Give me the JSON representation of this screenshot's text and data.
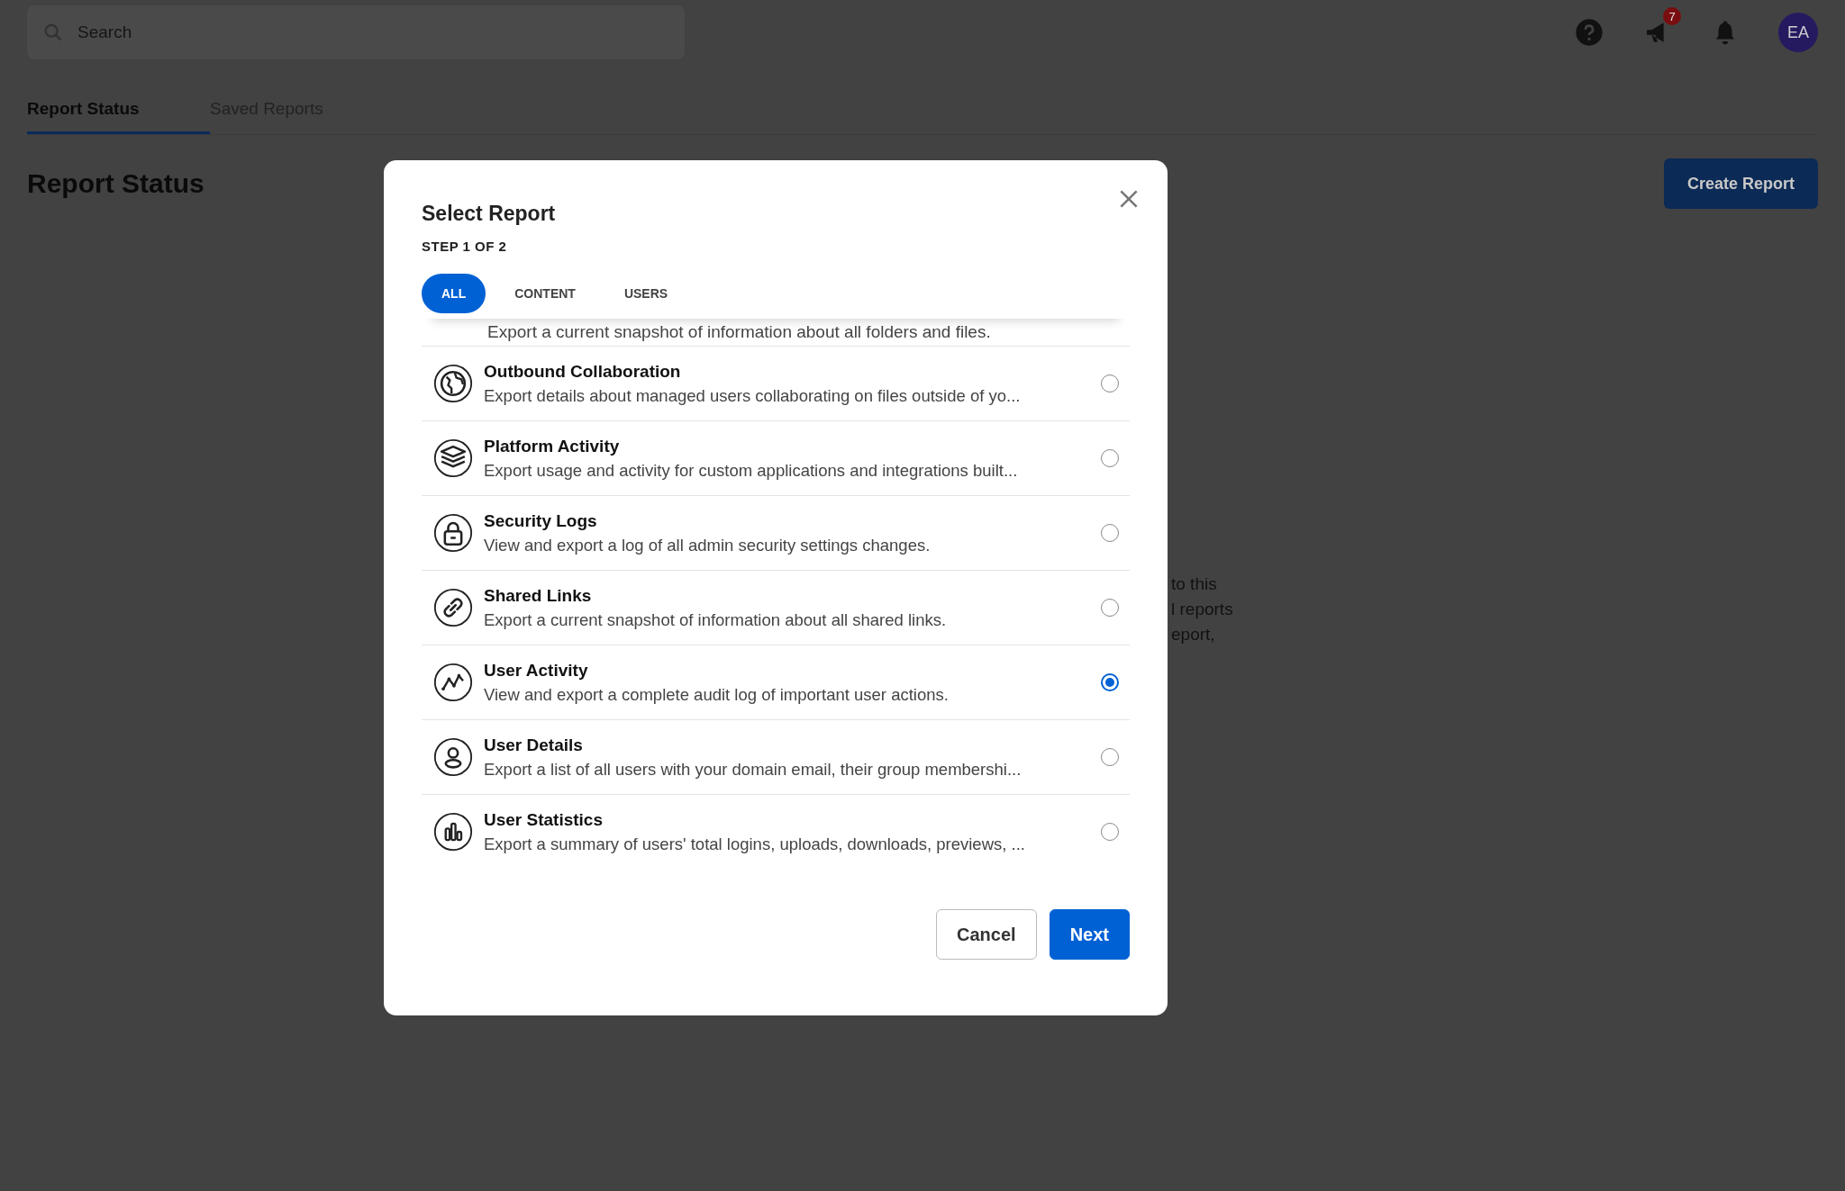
{
  "search": {
    "placeholder": "Search"
  },
  "notifications": {
    "badge": "7"
  },
  "avatar": {
    "initials": "EA"
  },
  "tabs": [
    {
      "label": "Report Status",
      "selected": true
    },
    {
      "label": "Saved Reports",
      "selected": false
    }
  ],
  "page_title": "Report Status",
  "create_button": "Create Report",
  "background_text": [
    "to this",
    "l reports",
    "eport,"
  ],
  "modal": {
    "title": "Select Report",
    "step": "STEP 1 OF 2",
    "filters": [
      {
        "label": "ALL",
        "selected": true
      },
      {
        "label": "CONTENT",
        "selected": false
      },
      {
        "label": "USERS",
        "selected": false
      }
    ],
    "scrolled_row": {
      "description": "Export a current snapshot of information about all folders and files."
    },
    "reports": [
      {
        "kind": "globe",
        "title": "Outbound Collaboration",
        "description": "Export details about managed users collaborating on files outside of yo...",
        "selected": false
      },
      {
        "kind": "layers",
        "title": "Platform Activity",
        "description": "Export usage and activity for custom applications and integrations built...",
        "selected": false
      },
      {
        "kind": "lock",
        "title": "Security Logs",
        "description": "View and export a log of all admin security settings changes.",
        "selected": false
      },
      {
        "kind": "link",
        "title": "Shared Links",
        "description": "Export a current snapshot of information about all shared links.",
        "selected": false
      },
      {
        "kind": "activity",
        "title": "User Activity",
        "description": "View and export a complete audit log of important user actions.",
        "selected": true
      },
      {
        "kind": "person",
        "title": "User Details",
        "description": "Export a list of all users with your domain email, their group membershi...",
        "selected": false
      },
      {
        "kind": "bars",
        "title": "User Statistics",
        "description": "Export a summary of users' total logins, uploads, downloads, previews, ...",
        "selected": false
      }
    ],
    "buttons": {
      "cancel": "Cancel",
      "next": "Next"
    }
  }
}
